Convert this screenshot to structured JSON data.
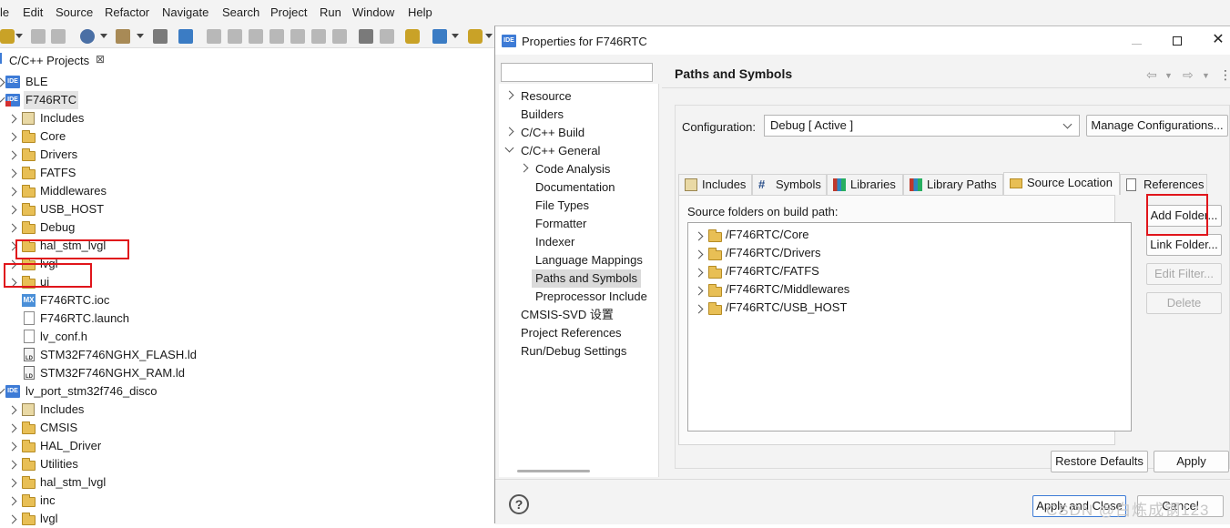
{
  "menu": [
    "le",
    "Edit",
    "Source",
    "Refactor",
    "Navigate",
    "Search",
    "Project",
    "Run",
    "Window",
    "Help"
  ],
  "project_panel": {
    "title": "C/C++ Projects",
    "close": "⊠",
    "items": [
      {
        "label": "BLE"
      },
      {
        "label": "F746RTC"
      },
      {
        "label": "Includes"
      },
      {
        "label": "Core"
      },
      {
        "label": "Drivers"
      },
      {
        "label": "FATFS"
      },
      {
        "label": "Middlewares"
      },
      {
        "label": "USB_HOST"
      },
      {
        "label": "Debug"
      },
      {
        "label": "hal_stm_lvgl"
      },
      {
        "label": "lvgl"
      },
      {
        "label": "ui"
      },
      {
        "label": "F746RTC.ioc"
      },
      {
        "label": "F746RTC.launch"
      },
      {
        "label": "lv_conf.h"
      },
      {
        "label": "STM32F746NGHX_FLASH.ld"
      },
      {
        "label": "STM32F746NGHX_RAM.ld"
      },
      {
        "label": "lv_port_stm32f746_disco"
      },
      {
        "label": "Includes"
      },
      {
        "label": "CMSIS"
      },
      {
        "label": "HAL_Driver"
      },
      {
        "label": "Utilities"
      },
      {
        "label": "hal_stm_lvgl"
      },
      {
        "label": "inc"
      },
      {
        "label": "lvgl"
      }
    ],
    "icon_text": {
      "ide": "IDE",
      "mx": "MX",
      "ld": "LD"
    }
  },
  "dialog": {
    "title": "Properties for F746RTC",
    "title_icon": "IDE",
    "filter_value": "",
    "nav": [
      {
        "label": "Resource"
      },
      {
        "label": "Builders"
      },
      {
        "label": "C/C++ Build"
      },
      {
        "label": "C/C++ General"
      },
      {
        "label": "Code Analysis"
      },
      {
        "label": "Documentation"
      },
      {
        "label": "File Types"
      },
      {
        "label": "Formatter"
      },
      {
        "label": "Indexer"
      },
      {
        "label": "Language Mappings"
      },
      {
        "label": "Paths and Symbols"
      },
      {
        "label": "Preprocessor Include"
      },
      {
        "label": "CMSIS-SVD 设置"
      },
      {
        "label": "Project References"
      },
      {
        "label": "Run/Debug Settings"
      }
    ],
    "heading": "Paths and Symbols",
    "config_label": "Configuration:",
    "config_value": "Debug  [ Active ]",
    "manage_button": "Manage Configurations...",
    "tabs": [
      {
        "label": "Includes"
      },
      {
        "label": "Symbols"
      },
      {
        "label": "Libraries"
      },
      {
        "label": "Library Paths"
      },
      {
        "label": "Source Location"
      },
      {
        "label": "References"
      }
    ],
    "symbols_glyph": "#",
    "list_label": "Source folders on build path:",
    "folders": [
      "/F746RTC/Core",
      "/F746RTC/Drivers",
      "/F746RTC/FATFS",
      "/F746RTC/Middlewares",
      "/F746RTC/USB_HOST"
    ],
    "side_buttons": {
      "add_folder": "Add Folder...",
      "link_folder": "Link Folder...",
      "edit_filter": "Edit Filter...",
      "delete": "Delete"
    },
    "restore_defaults": "Restore Defaults",
    "apply": "Apply",
    "apply_and_close": "Apply and Close",
    "cancel": "Cancel",
    "help_glyph": "?"
  },
  "watermark": "CSDN @白炼成钢123",
  "colors": {
    "highlight_box": "#e0151b",
    "ide_blue": "#3d7bd6",
    "folder": "#e8bf55"
  }
}
